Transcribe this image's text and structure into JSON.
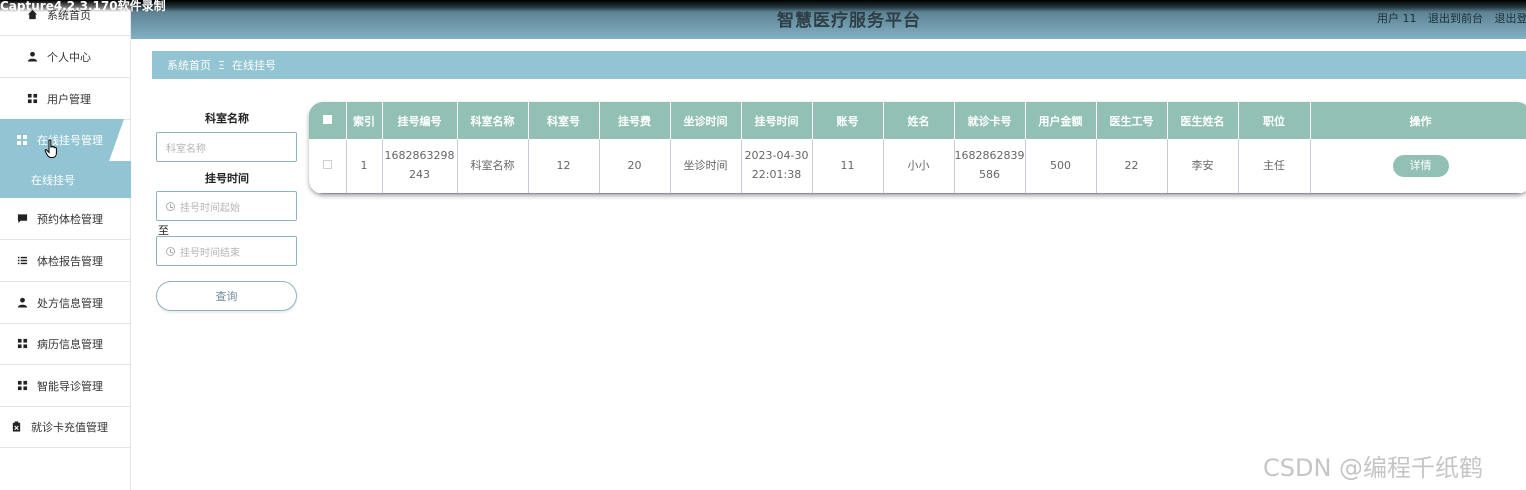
{
  "capture_title": "Capture4.2.3.170软件录制",
  "header": {
    "title": "智慧医疗服务平台",
    "user_label": "用户 11",
    "back_front": "退出到前台",
    "logout": "退出登"
  },
  "sidebar": {
    "items": [
      {
        "label": "系统首页",
        "icon": "home-icon"
      },
      {
        "label": "个人中心",
        "icon": "person-icon"
      },
      {
        "label": "用户管理",
        "icon": "grid-icon"
      },
      {
        "label": "在线挂号管理",
        "icon": "grid-icon"
      },
      {
        "label": "预约体检管理",
        "icon": "comment-icon"
      },
      {
        "label": "体检报告管理",
        "icon": "list-icon"
      },
      {
        "label": "处方信息管理",
        "icon": "person-icon"
      },
      {
        "label": "病历信息管理",
        "icon": "grid-icon"
      },
      {
        "label": "智能导诊管理",
        "icon": "grid-icon"
      },
      {
        "label": "就诊卡充值管理",
        "icon": "clipboard-icon"
      }
    ],
    "submenu": "在线挂号"
  },
  "breadcrumb": {
    "home": "系统首页",
    "separator": "Ξ",
    "current": "在线挂号"
  },
  "search": {
    "dept_label": "科室名称",
    "dept_placeholder": "科室名称",
    "time_label": "挂号时间",
    "time_start_placeholder": "挂号时间起始",
    "to_text": "至",
    "time_end_placeholder": "挂号时间结束",
    "query_button": "查询"
  },
  "table": {
    "columns": [
      "索引",
      "挂号编号",
      "科室名称",
      "科室号",
      "挂号费",
      "坐诊时间",
      "挂号时间",
      "账号",
      "姓名",
      "就诊卡号",
      "用户金额",
      "医生工号",
      "医生姓名",
      "职位",
      "操作"
    ],
    "rows": [
      {
        "index": "1",
        "reg_no": "1682863298243",
        "dept_name": "科室名称",
        "dept_no": "12",
        "fee": "20",
        "clinic_time": "坐诊时间",
        "reg_time": "2023-04-30 22:01:38",
        "account": "11",
        "name": "小小",
        "card_no": "1682862839586",
        "amount": "500",
        "doctor_no": "22",
        "doctor_name": "李安",
        "position": "主任",
        "action": "详情"
      }
    ]
  },
  "watermark": "CSDN @编程千纸鹤",
  "colors": {
    "accent": "#92c4d3",
    "table_header": "#92c0b5",
    "header_dark": "#4b6f80"
  }
}
